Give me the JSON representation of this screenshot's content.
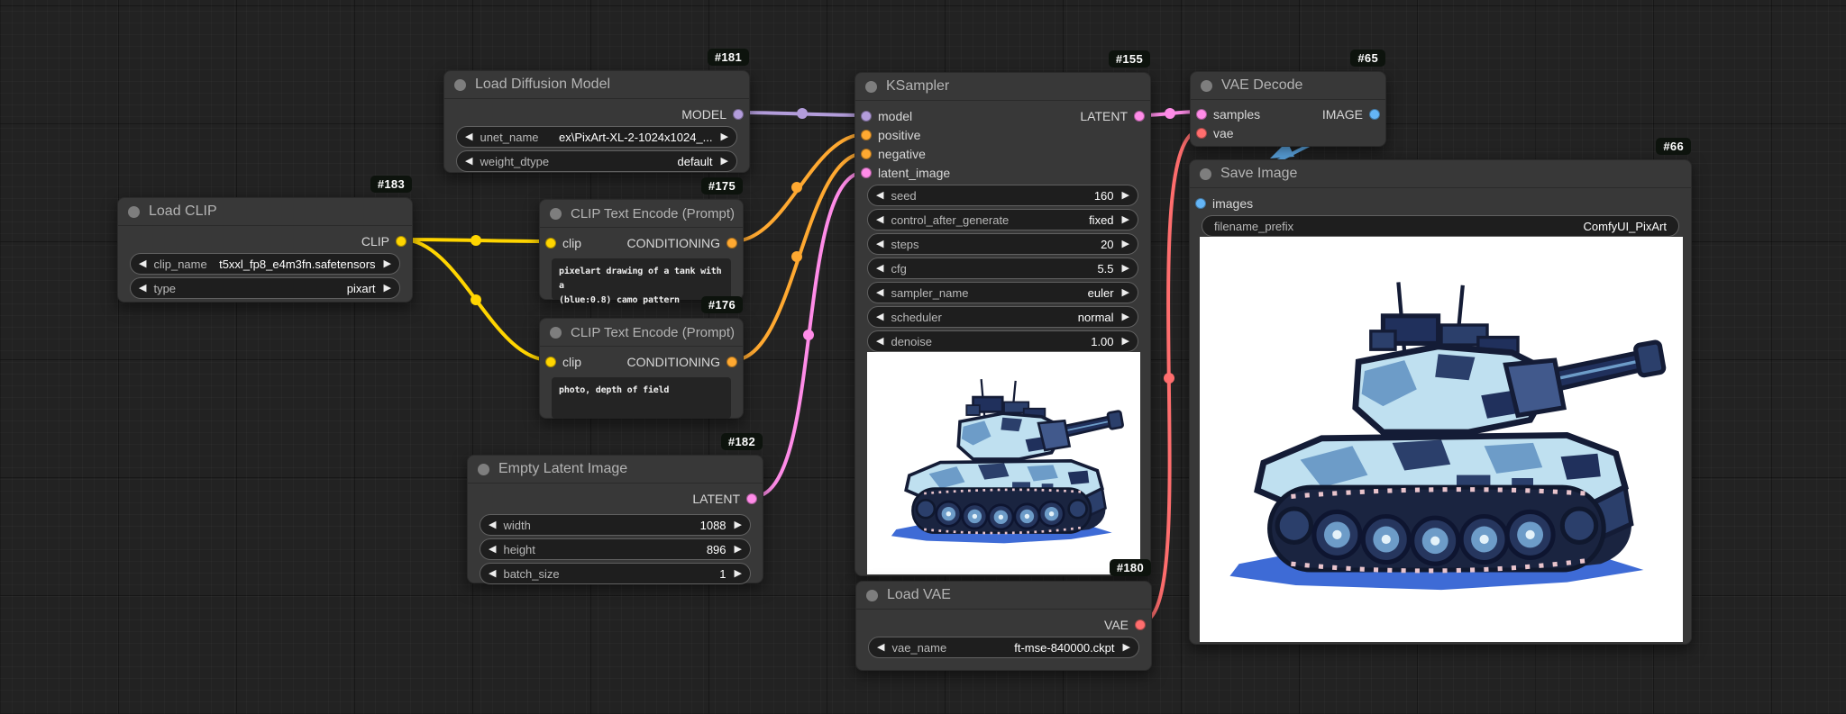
{
  "colors": {
    "model": "#B39DDB",
    "clip": "#FFD500",
    "conditioning": "#FFA931",
    "latent": "#FF8CE8",
    "vae": "#FF6E6E",
    "image": "#64B5F6",
    "badge": "#0d130d",
    "shadow": "#3E6BD6"
  },
  "nodes": {
    "load_diffusion_model": {
      "badge": "#181",
      "title": "Load Diffusion Model",
      "outputs": [
        {
          "label": "MODEL"
        }
      ],
      "widgets": [
        {
          "label": "unet_name",
          "value": "ex\\PixArt-XL-2-1024x1024_..."
        },
        {
          "label": "weight_dtype",
          "value": "default"
        }
      ]
    },
    "load_clip": {
      "badge": "#183",
      "title": "Load CLIP",
      "outputs": [
        {
          "label": "CLIP"
        }
      ],
      "widgets": [
        {
          "label": "clip_name",
          "value": "t5xxl_fp8_e4m3fn.safetensors"
        },
        {
          "label": "type",
          "value": "pixart"
        }
      ]
    },
    "clip_text_encode_positive": {
      "badge": "#175",
      "title": "CLIP Text Encode (Prompt)",
      "inputs": [
        {
          "label": "clip"
        }
      ],
      "outputs": [
        {
          "label": "CONDITIONING"
        }
      ],
      "text": "pixelart drawing of a tank with a\n(blue:0.8) camo pattern"
    },
    "clip_text_encode_negative": {
      "badge": "#176",
      "title": "CLIP Text Encode (Prompt)",
      "inputs": [
        {
          "label": "clip"
        }
      ],
      "outputs": [
        {
          "label": "CONDITIONING"
        }
      ],
      "text": "photo, depth of field"
    },
    "empty_latent_image": {
      "badge": "#182",
      "title": "Empty Latent Image",
      "outputs": [
        {
          "label": "LATENT"
        }
      ],
      "widgets": [
        {
          "label": "width",
          "value": "1088"
        },
        {
          "label": "height",
          "value": "896"
        },
        {
          "label": "batch_size",
          "value": "1"
        }
      ]
    },
    "ksampler": {
      "badge": "#155",
      "title": "KSampler",
      "inputs": [
        {
          "label": "model"
        },
        {
          "label": "positive"
        },
        {
          "label": "negative"
        },
        {
          "label": "latent_image"
        }
      ],
      "outputs": [
        {
          "label": "LATENT"
        }
      ],
      "widgets": [
        {
          "label": "seed",
          "value": "160"
        },
        {
          "label": "control_after_generate",
          "value": "fixed"
        },
        {
          "label": "steps",
          "value": "20"
        },
        {
          "label": "cfg",
          "value": "5.5"
        },
        {
          "label": "sampler_name",
          "value": "euler"
        },
        {
          "label": "scheduler",
          "value": "normal"
        },
        {
          "label": "denoise",
          "value": "1.00"
        }
      ],
      "preview": "pixelart blue camo tank on white background"
    },
    "vae_decode": {
      "badge": "#65",
      "title": "VAE Decode",
      "inputs": [
        {
          "label": "samples"
        },
        {
          "label": "vae"
        }
      ],
      "outputs": [
        {
          "label": "IMAGE"
        }
      ]
    },
    "save_image": {
      "badge": "#66",
      "title": "Save Image",
      "inputs": [
        {
          "label": "images"
        }
      ],
      "widgets": [
        {
          "label": "filename_prefix",
          "value": "ComfyUI_PixArt"
        }
      ],
      "preview": "pixelart blue camo tank on white background"
    },
    "load_vae": {
      "badge": "#180",
      "title": "Load VAE",
      "outputs": [
        {
          "label": "VAE"
        }
      ],
      "widgets": [
        {
          "label": "vae_name",
          "value": "ft-mse-840000.ckpt"
        }
      ]
    }
  },
  "links": [
    {
      "from": "Load Diffusion Model.MODEL",
      "to": "KSampler.model",
      "type": "MODEL"
    },
    {
      "from": "Load CLIP.CLIP",
      "to": "CLIP Text Encode (Prompt) #175.clip",
      "type": "CLIP"
    },
    {
      "from": "Load CLIP.CLIP",
      "to": "CLIP Text Encode (Prompt) #176.clip",
      "type": "CLIP"
    },
    {
      "from": "CLIP Text Encode (Prompt) #175.CONDITIONING",
      "to": "KSampler.positive",
      "type": "CONDITIONING"
    },
    {
      "from": "CLIP Text Encode (Prompt) #176.CONDITIONING",
      "to": "KSampler.negative",
      "type": "CONDITIONING"
    },
    {
      "from": "Empty Latent Image.LATENT",
      "to": "KSampler.latent_image",
      "type": "LATENT"
    },
    {
      "from": "KSampler.LATENT",
      "to": "VAE Decode.samples",
      "type": "LATENT"
    },
    {
      "from": "Load VAE.VAE",
      "to": "VAE Decode.vae",
      "type": "VAE"
    },
    {
      "from": "VAE Decode.IMAGE",
      "to": "Save Image.images",
      "type": "IMAGE"
    }
  ]
}
